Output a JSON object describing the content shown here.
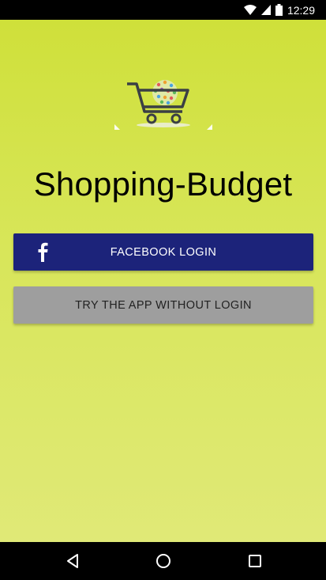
{
  "status_bar": {
    "time": "12:29",
    "icons": [
      "wifi-icon",
      "signal-icon",
      "battery-icon"
    ]
  },
  "app": {
    "title": "Shopping-Budget",
    "logo": "shopping-cart-logo",
    "background_colors": [
      "#cfe03a",
      "#e0e977"
    ]
  },
  "buttons": {
    "facebook_login": {
      "label": "FACEBOOK LOGIN",
      "icon": "facebook-icon",
      "color": "#1c237a"
    },
    "guest_login": {
      "label": "TRY THE APP WITHOUT LOGIN",
      "color": "#9e9e9e"
    }
  },
  "nav_bar": {
    "items": [
      "back-icon",
      "home-icon",
      "recents-icon"
    ]
  }
}
